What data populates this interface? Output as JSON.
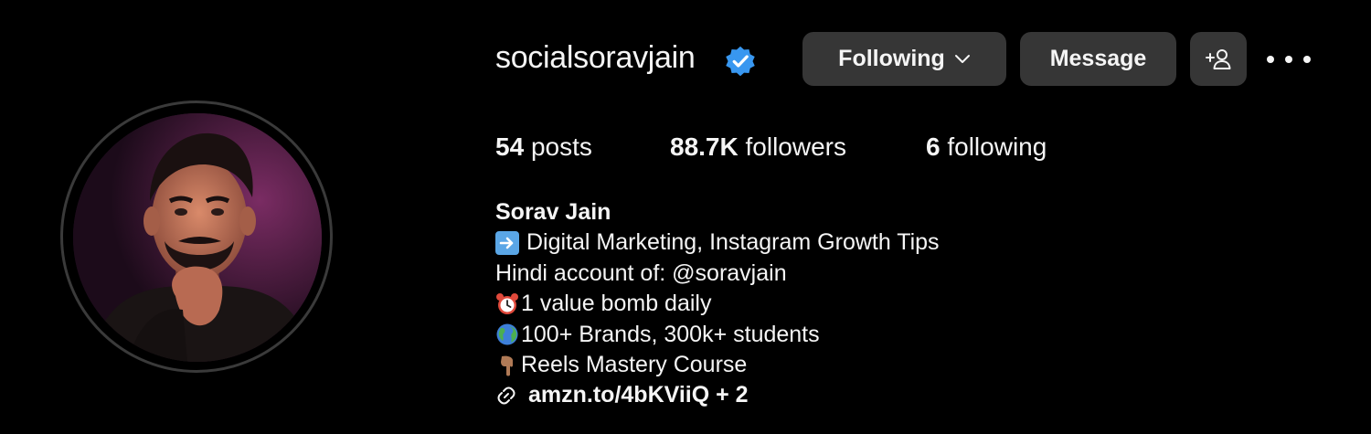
{
  "profile": {
    "username": "socialsoravjain",
    "verified": true,
    "verified_color": "#3897f0"
  },
  "actions": {
    "following_label": "Following",
    "message_label": "Message",
    "add_user_icon": "person-plus-icon",
    "more_icon": "more-horizontal-icon"
  },
  "stats": {
    "posts_count": "54",
    "posts_label": "posts",
    "followers_count": "88.7K",
    "followers_label": "followers",
    "following_count": "6",
    "following_label": "following"
  },
  "bio": {
    "name": "Sorav Jain",
    "lines": [
      {
        "emoji": "right-arrow-emoji",
        "text": "Digital Marketing, Instagram Growth Tips"
      },
      {
        "emoji": "",
        "text": "Hindi account of: @soravjain"
      },
      {
        "emoji": "alarm-clock-emoji",
        "text": "1 value bomb daily"
      },
      {
        "emoji": "globe-emoji",
        "text": "100+ Brands, 300k+ students"
      },
      {
        "emoji": "pointing-down-emoji",
        "text": "Reels Mastery Course"
      }
    ],
    "link_text": "amzn.to/4bKViiQ + 2",
    "link_icon": "link-icon"
  },
  "colors": {
    "background": "#000000",
    "button_bg": "#363636",
    "text": "#f5f5f5"
  }
}
